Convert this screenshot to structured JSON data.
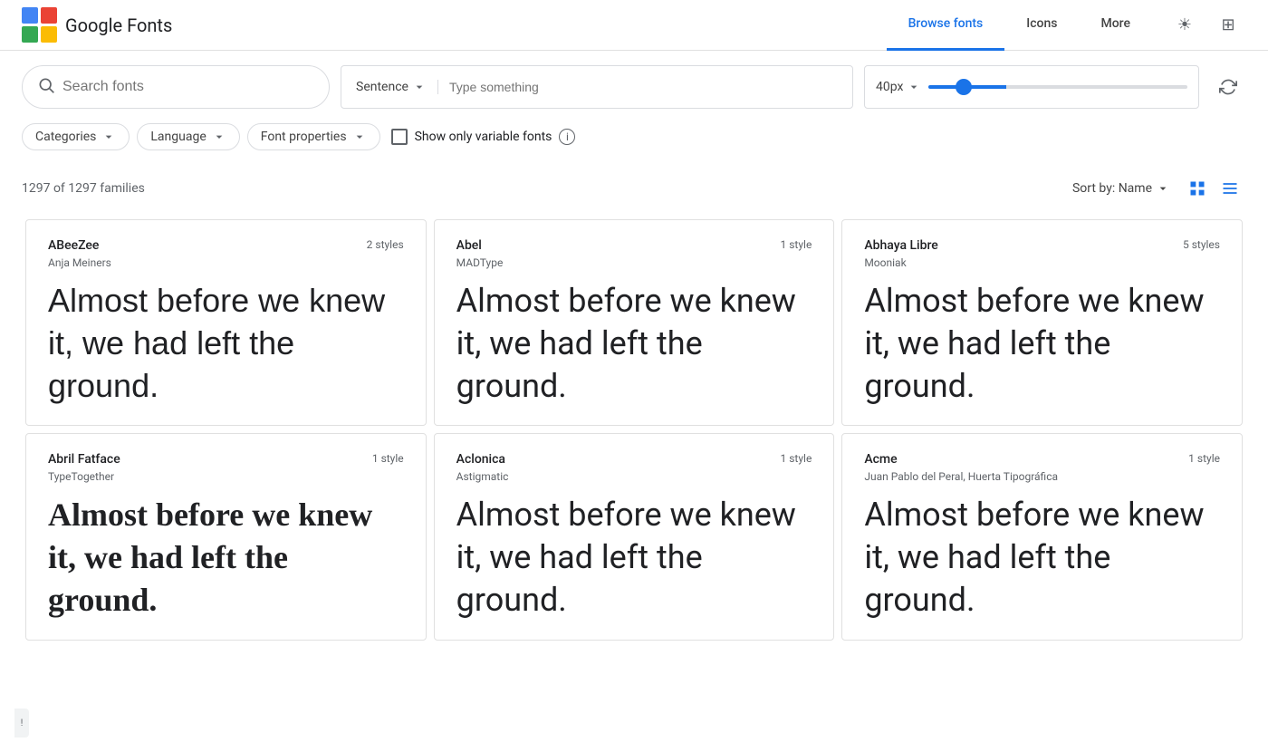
{
  "header": {
    "logo_text": "Google Fonts",
    "nav": [
      {
        "id": "browse",
        "label": "Browse fonts",
        "active": true
      },
      {
        "id": "icons",
        "label": "Icons",
        "active": false
      },
      {
        "id": "more",
        "label": "More",
        "active": false
      }
    ],
    "icons": [
      {
        "id": "theme",
        "symbol": "☀",
        "label": "Theme toggle"
      },
      {
        "id": "grid",
        "symbol": "⊞",
        "label": "Grid toggle"
      }
    ]
  },
  "search": {
    "placeholder": "Search fonts",
    "sentence_label": "Sentence",
    "preview_placeholder": "Type something",
    "size_label": "40px",
    "size_value": 40,
    "size_min": 8,
    "size_max": 300
  },
  "filters": {
    "categories_label": "Categories",
    "language_label": "Language",
    "font_properties_label": "Font properties",
    "variable_fonts_label": "Show only variable fonts",
    "variable_fonts_checked": false
  },
  "results": {
    "count_text": "1297 of 1297 families",
    "sort_label": "Sort by: Name",
    "view_grid_title": "Grid view",
    "view_list_title": "List view"
  },
  "fonts": [
    {
      "name": "ABeeZee",
      "author": "Anja Meiners",
      "styles": "2 styles",
      "preview": "Almost before we knew it, we had left the ground.",
      "font_style": "sans"
    },
    {
      "name": "Abel",
      "author": "MADType",
      "styles": "1 style",
      "preview": "Almost before we knew it, we had left the ground.",
      "font_style": "condensed"
    },
    {
      "name": "Abhaya Libre",
      "author": "Mooniak",
      "styles": "5 styles",
      "preview": "Almost before we knew it, we had left the ground.",
      "font_style": "serif"
    },
    {
      "name": "Abril Fatface",
      "author": "TypeTogether",
      "styles": "1 style",
      "preview": "Almost before we knew it, we had left the ground.",
      "font_style": "abril"
    },
    {
      "name": "Aclonica",
      "author": "Astigmatic",
      "styles": "1 style",
      "preview": "Almost before we knew it, we had left the ground.",
      "font_style": "aclonica"
    },
    {
      "name": "Acme",
      "author": "Juan Pablo del Peral, Huerta Tipográfica",
      "styles": "1 style",
      "preview": "Almost before we knew it, we had left the ground.",
      "font_style": "acme"
    }
  ]
}
